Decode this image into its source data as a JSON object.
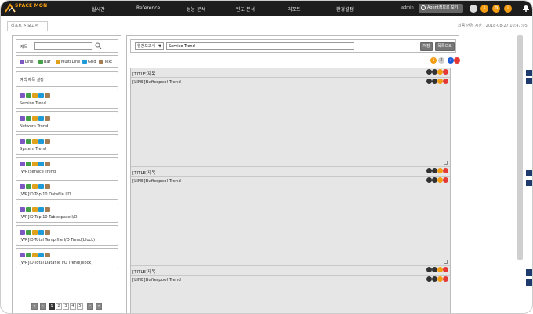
{
  "app": {
    "logo_text": "SPACE MON",
    "nav": [
      "실시간",
      "Reference",
      "성능 분석",
      "빈도 분석",
      "리포트",
      "환경설정"
    ],
    "user": "admin",
    "agent_button": "Agent정보로 보기"
  },
  "breadcrumb": "리포트 > 보고서",
  "last_change": "최종 변경 시간 : 2018-08-27 10:47:05",
  "left": {
    "search_label": "제목",
    "search_value": "",
    "legend": [
      {
        "label": "Line",
        "color": "#7e57c2"
      },
      {
        "label": "Bar",
        "color": "#43a047"
      },
      {
        "label": "Multi Line",
        "color": "#e0a21b"
      },
      {
        "label": "Grid",
        "color": "#1e9bd7"
      },
      {
        "label": "Text",
        "color": "#a67c52"
      }
    ],
    "items": [
      {
        "label": "여백 제목 설정",
        "plain": true
      },
      {
        "label": "Service Trend"
      },
      {
        "label": "Network Trend"
      },
      {
        "label": "System Trend"
      },
      {
        "label": "[WR]Service Trend"
      },
      {
        "label": "[WR]IO-Top 10 Datafile I/O"
      },
      {
        "label": "[WR]IO-Top 10 Tablespace I/O"
      },
      {
        "label": "[WR]IO-Total Temp file I/O Trend(block)"
      },
      {
        "label": "[WR]IO-Total Datafile I/O Trend(block)"
      }
    ],
    "chip_colors": [
      "#7e57c2",
      "#43a047",
      "#e0a21b",
      "#1e9bd7",
      "#a67c52"
    ],
    "pager": {
      "first": "«",
      "prev": "‹",
      "pages": [
        "1",
        "2",
        "3",
        "4",
        "5"
      ],
      "next": "›",
      "last": "»",
      "active": "1"
    }
  },
  "right": {
    "report_type": "월간보고서",
    "report_title": "Service Trend",
    "save_label": "저장",
    "list_label": "목록으로",
    "mini_ctrls": [
      "1",
      "2",
      "+",
      "−"
    ],
    "rows": [
      {
        "text": "[TITLE]제목"
      },
      {
        "text": "[LINE]Bufferpool Trend"
      },
      {
        "text": "[TITLE]제목"
      },
      {
        "text": "[LINE]Bufferpool Trend"
      },
      {
        "text": "[TITLE]제목"
      },
      {
        "text": "[LINE]Bufferpool Trend"
      }
    ]
  },
  "icon_colors": {
    "dark": "#333",
    "orange": "#f39c12",
    "red": "#e53935",
    "blue": "#1e5bd7"
  }
}
